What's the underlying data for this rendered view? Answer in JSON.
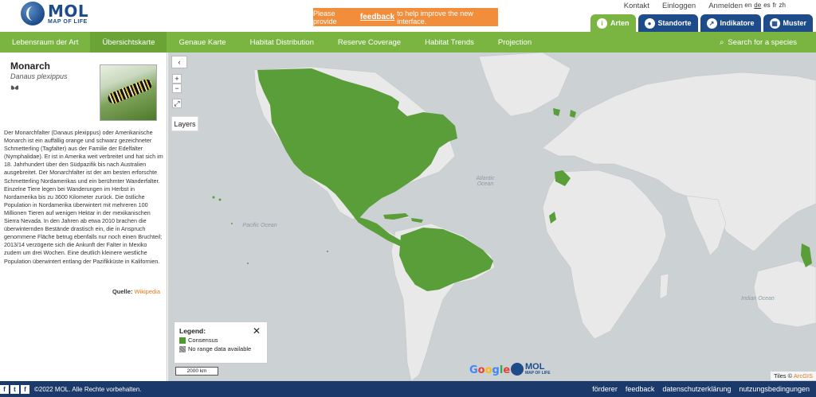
{
  "header": {
    "logo_main": "MOL",
    "logo_sub": "MAP OF LIFE",
    "feedback_prefix": "Please provide",
    "feedback_link": "feedback",
    "feedback_suffix": "to help improve the new interface.",
    "links": [
      "Kontakt",
      "Einloggen",
      "Anmelden"
    ],
    "languages": [
      "en",
      "de",
      "es",
      "fr",
      "zh"
    ],
    "active_language": "de",
    "tabs": [
      {
        "label": "Arten",
        "icon": "info-icon",
        "active": true
      },
      {
        "label": "Standorte",
        "icon": "location-pin-icon",
        "active": false
      },
      {
        "label": "Indikatore",
        "icon": "chart-icon",
        "active": false
      },
      {
        "label": "Muster",
        "icon": "grid-icon",
        "active": false
      }
    ]
  },
  "nav": {
    "items": [
      "Lebensraum der Art",
      "Übersichtskarte",
      "Genaue Karte",
      "Habitat Distribution",
      "Reserve Coverage",
      "Habitat Trends",
      "Projection"
    ],
    "active": "Übersichtskarte",
    "search_label": "Search for a species"
  },
  "species": {
    "common_name": "Monarch",
    "scientific_name": "Danaus plexippus",
    "icon": "butterfly-icon",
    "description": "Der Monarchfalter (Danaus plexippus) oder Amerikanische Monarch ist ein auffällig orange und schwarz gezeichneter Schmetterling (Tagfalter) aus der Familie der Edelfalter (Nymphalidae). Er ist in Amerika weit verbreitet und hat sich im 18. Jahrhundert über den Südpazifik bis nach Australien ausgebreitet. Der Monarchfalter ist der am besten erforschte Schmetterling Nordamerikas und ein berühmter Wanderfalter. Einzelne Tiere legen bei Wanderungen im Herbst in Nordamerika bis zu 3600 Kilometer zurück. Die östliche Population in Nordamerika überwintert mit mehreren 100 Millionen Tieren auf wenigen Hektar in der mexikanischen Sierra Nevada. In den Jahren ab etwa 2010 brachen die überwinternden Bestände drastisch ein, die in Anspruch genommene Fläche betrug ebenfalls nur noch einen Bruchteil; 2013/14 verzögerte sich die Ankunft der Falter in Mexiko zudem um drei Wochen. Eine deutlich kleinere westliche Population überwintert entlang der Pazifikküste in Kalifornien.",
    "source_label": "Quelle:",
    "source_link": "Wikipedia"
  },
  "map": {
    "collapse_label": "‹",
    "zoom_in": "+",
    "zoom_out": "−",
    "fullscreen_icon": "expand-icon",
    "layers_label": "Layers",
    "ocean_labels": [
      "Atlantic Ocean",
      "Pacific Ocean",
      "Indian Ocean"
    ],
    "legend": {
      "title": "Legend:",
      "close": "✕",
      "items": [
        {
          "label": "Consensus",
          "color": "#4f9a2f"
        },
        {
          "label": "No range data available",
          "color": "#8a8a8a"
        }
      ]
    },
    "scale_label": "2000 km",
    "google_label": "Google",
    "tiles_prefix": "Tiles ©",
    "tiles_link": "ArcGIS",
    "range_color": "#5a9e3a",
    "land_color": "#e9e9e9",
    "water_color": "#ccd1d4"
  },
  "footer": {
    "copyright": "©2022 MOL. Alle Rechte vorbehalten.",
    "social": [
      "f-icon",
      "twitter-icon",
      "facebook-icon"
    ],
    "links": [
      "förderer",
      "feedback",
      "datenschutzerklärung",
      "nutzungsbedingungen"
    ]
  }
}
